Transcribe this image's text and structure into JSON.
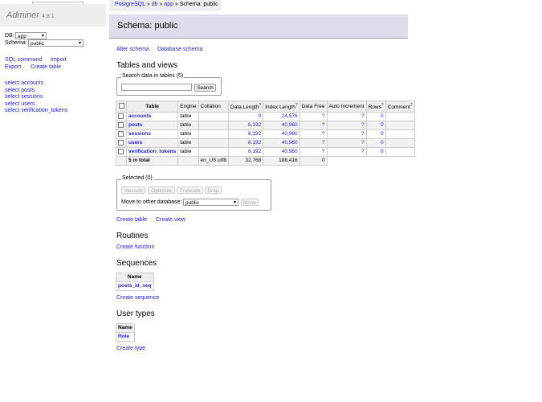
{
  "app": {
    "name": "Adminer",
    "version": "4.8.1"
  },
  "sidebar": {
    "db_label": "DB:",
    "db_value": "app",
    "schema_label": "Schema:",
    "schema_value": "public",
    "links1": [
      "SQL command",
      "Import"
    ],
    "links2": [
      "Export",
      "Create table"
    ],
    "tables": [
      "select accounts",
      "select posts",
      "select sessions",
      "select users",
      "select verification_tokens"
    ]
  },
  "breadcrumb": {
    "parts": [
      "PostgreSQL",
      "db",
      "app"
    ],
    "sep": "»",
    "current": "Schema: public"
  },
  "page_title": "Schema: public",
  "schema_links": [
    "Alter schema",
    "Database schema"
  ],
  "tables_heading": "Tables and views",
  "search": {
    "legend": "Search data in tables (5)",
    "button": "Search"
  },
  "tables_table": {
    "headers": [
      "Table",
      "Engine",
      "Collation",
      "Data Length",
      "Index Length",
      "Data Free",
      "Auto Increment",
      "Rows",
      "Comment"
    ],
    "help_mark": "?",
    "rows": [
      {
        "name": "accounts",
        "engine": "table",
        "collation": "",
        "data_length": "0",
        "index_length": "24,576",
        "data_free": "?",
        "auto_inc": "?",
        "rows": "0",
        "comment": ""
      },
      {
        "name": "posts",
        "engine": "table",
        "collation": "",
        "data_length": "8,192",
        "index_length": "40,960",
        "data_free": "?",
        "auto_inc": "?",
        "rows": "0",
        "comment": ""
      },
      {
        "name": "sessions",
        "engine": "table",
        "collation": "",
        "data_length": "8,192",
        "index_length": "40,960",
        "data_free": "?",
        "auto_inc": "?",
        "rows": "0",
        "comment": ""
      },
      {
        "name": "users",
        "engine": "table",
        "collation": "",
        "data_length": "8,192",
        "index_length": "40,960",
        "data_free": "?",
        "auto_inc": "?",
        "rows": "0",
        "comment": ""
      },
      {
        "name": "verification_tokens",
        "engine": "table",
        "collation": "",
        "data_length": "8,192",
        "index_length": "40,960",
        "data_free": "?",
        "auto_inc": "?",
        "rows": "0",
        "comment": ""
      }
    ],
    "total": {
      "label": "5 in total",
      "collation": "en_US.utf8",
      "data_length": "32,768",
      "index_length": "188,416",
      "data_free": "0"
    }
  },
  "selected": {
    "legend": "Selected (0)",
    "buttons": [
      "Vacuum",
      "Optimize",
      "Truncate",
      "Drop"
    ],
    "move_label": "Move to other database:",
    "move_value": "public",
    "move_button": "Move"
  },
  "create_links": [
    "Create table",
    "Create view"
  ],
  "routines": {
    "heading": "Routines",
    "link": "Create function"
  },
  "sequences": {
    "heading": "Sequences",
    "column": "Name",
    "items": [
      "posts_id_seq"
    ],
    "link": "Create sequence"
  },
  "user_types": {
    "heading": "User types",
    "column": "Name",
    "items": [
      "Role"
    ],
    "link": "Create type"
  }
}
